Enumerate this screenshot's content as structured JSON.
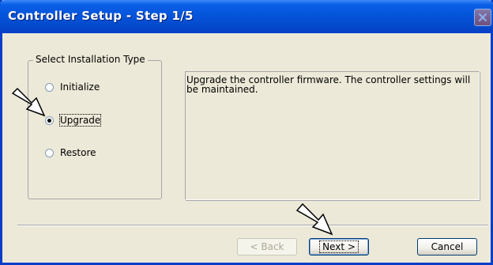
{
  "window": {
    "title": "Controller Setup - Step 1/5"
  },
  "install_type": {
    "legend": "Select Installation Type",
    "options": [
      {
        "label": "Initialize",
        "selected": false
      },
      {
        "label": "Upgrade",
        "selected": true
      },
      {
        "label": "Restore",
        "selected": false
      }
    ],
    "description": "Upgrade the controller firmware. The controller settings will be maintained."
  },
  "buttons": {
    "back": "< Back",
    "next": "Next >",
    "cancel": "Cancel"
  },
  "icons": {
    "close": "close-icon",
    "pointer": "arrow-pointer-icon"
  },
  "colors": {
    "titlebar": "#0453d9",
    "dialog_bg": "#ece9d8",
    "disabled_text": "#aca899"
  }
}
